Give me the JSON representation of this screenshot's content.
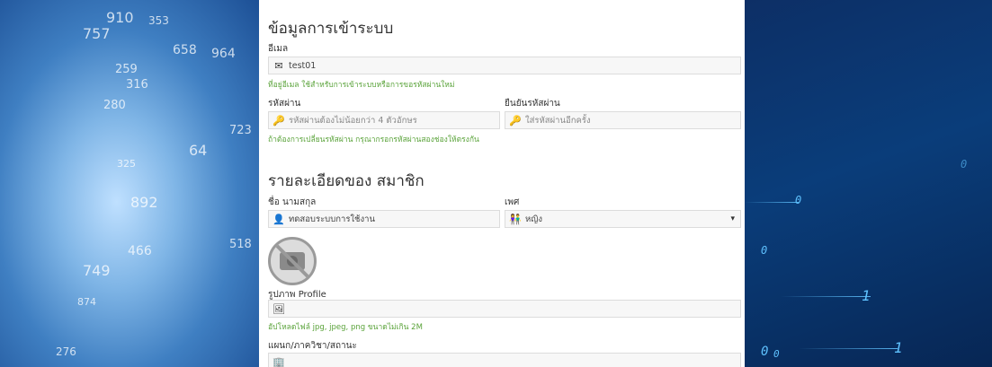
{
  "login_section": {
    "title": "ข้อมูลการเข้าระบบ",
    "email_label": "อีเมล",
    "email_value": "test01",
    "email_help": "ที่อยู่อีเมล ใช้สำหรับการเข้าระบบหรือการขอรหัสผ่านใหม่",
    "password_label": "รหัสผ่าน",
    "password_placeholder": "รหัสผ่านต้องไม่น้อยกว่า 4 ตัวอักษร",
    "confirm_label": "ยืนยันรหัสผ่าน",
    "confirm_placeholder": "ใส่รหัสผ่านอีกครั้ง",
    "password_help": "ถ้าต้องการเปลี่ยนรหัสผ่าน กรุณากรอกรหัสผ่านสองช่องให้ตรงกัน"
  },
  "member_section": {
    "title": "รายละเอียดของ สมาชิก",
    "name_label": "ชื่อ นามสกุล",
    "name_value": "ทดสอบระบบการใช้งาน",
    "gender_label": "เพศ",
    "gender_value": "หญิง",
    "profile_label": "รูปภาพ Profile",
    "upload_help": "อัปโหลดไฟล์ jpg, jpeg, png ขนาดไม่เกิน 2M",
    "department_label": "แผนก/ภาควิชา/สถานะ"
  },
  "background_left_numbers": [
    "910",
    "353",
    "757",
    "658",
    "964",
    "259",
    "316",
    "280",
    "723",
    "64",
    "325",
    "892",
    "466",
    "749",
    "518",
    "874",
    "276"
  ],
  "background_right_digits": [
    "0",
    "0",
    "0",
    "1",
    "1",
    "0",
    "0"
  ],
  "colors": {
    "help_green": "#5aa33a",
    "panel_bg": "#ffffff",
    "field_bg": "#f7f7f7"
  }
}
